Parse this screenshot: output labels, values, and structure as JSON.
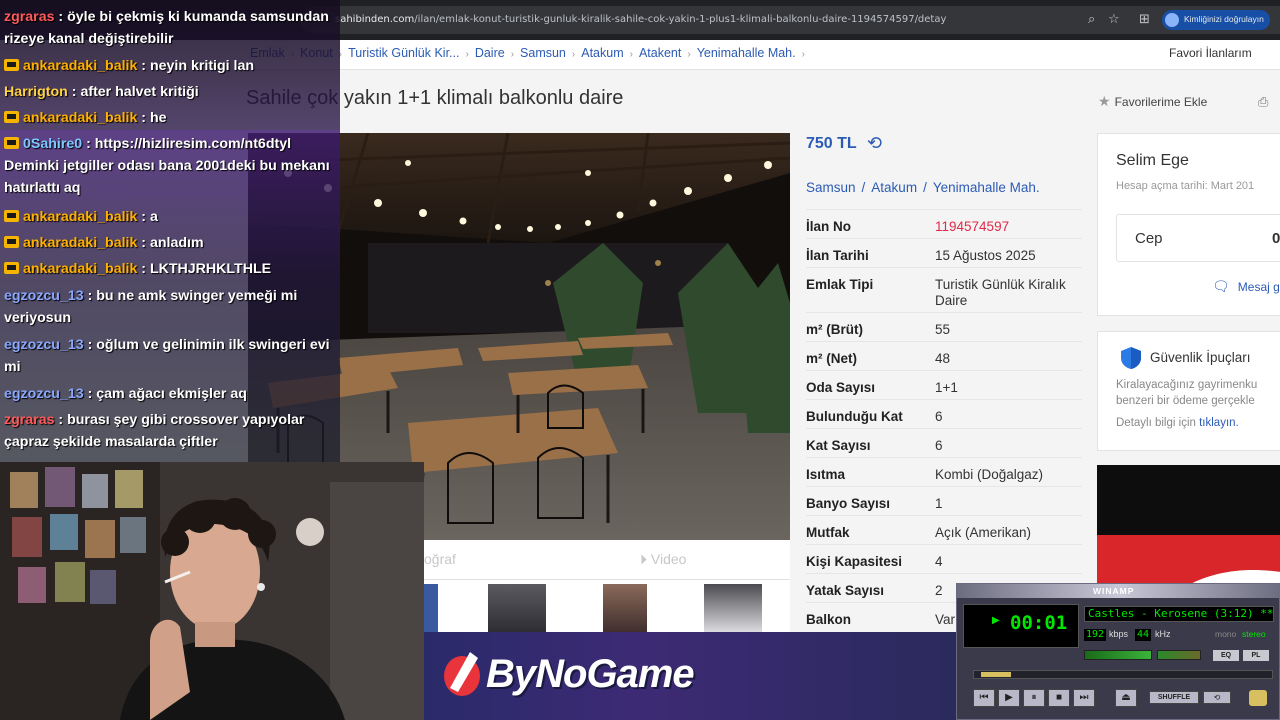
{
  "browser": {
    "url_prefix": "sahibinden.com",
    "url_path": "/ilan/emlak-konut-turistik-gunluk-kiralik-sahile-cok-yakin-1-plus1-klimali-balkonlu-daire-1194574597/detay",
    "verify_label": "Kimliğinizi doğrulayın"
  },
  "breadcrumbs": [
    "Emlak",
    "Konut",
    "Turistik Günlük Kir...",
    "Daire",
    "Samsun",
    "Atakum",
    "Atakent",
    "Yenimahalle Mah."
  ],
  "header": {
    "favorites_link": "Favori İlanlarım",
    "title": "Sahile çok yakın 1+1 klimalı balkonlu daire",
    "add_favorite": "Favorilerime Ekle",
    "print_label": "Y"
  },
  "photo_tabs": {
    "photo": "oğraf",
    "video": "Video"
  },
  "listing": {
    "price": "750 TL",
    "location": [
      "Samsun",
      "Atakum",
      "Yenimahalle Mah."
    ],
    "rows": [
      {
        "k": "İlan No",
        "v": "1194574597"
      },
      {
        "k": "İlan Tarihi",
        "v": "15 Ağustos 2025"
      },
      {
        "k": "Emlak Tipi",
        "v": "Turistik Günlük Kiralık Daire"
      },
      {
        "k": "m² (Brüt)",
        "v": "55"
      },
      {
        "k": "m² (Net)",
        "v": "48"
      },
      {
        "k": "Oda Sayısı",
        "v": "1+1"
      },
      {
        "k": "Bulunduğu Kat",
        "v": "6"
      },
      {
        "k": "Kat Sayısı",
        "v": "6"
      },
      {
        "k": "Isıtma",
        "v": "Kombi (Doğalgaz)"
      },
      {
        "k": "Banyo Sayısı",
        "v": "1"
      },
      {
        "k": "Mutfak",
        "v": "Açık (Amerikan)"
      },
      {
        "k": "Kişi Kapasitesi",
        "v": "4"
      },
      {
        "k": "Yatak Sayısı",
        "v": "2"
      },
      {
        "k": "Balkon",
        "v": "Var"
      }
    ]
  },
  "seller": {
    "name": "Selim Ege",
    "joined": "Hesap açma tarihi: Mart 201",
    "phone_label": "Cep",
    "phone_value": "0",
    "message": "Mesaj g"
  },
  "safety": {
    "title": "Güvenlik İpuçları",
    "line1": "Kiralayacağınız gayrimenku",
    "line2": "benzeri bir ödeme gerçekle",
    "more_prefix": "Detaylı bilgi için",
    "more_link": "tıklayın."
  },
  "chat": [
    {
      "user": "zgraras",
      "color": "#ff5a5a",
      "badge": false,
      "text": "öyle bi çekmiş ki kumanda samsundan rizeye kanal değiştirebilir"
    },
    {
      "user": "ankaradaki_balik",
      "color": "#ffb000",
      "badge": true,
      "text": "neyin kritigi lan"
    },
    {
      "user": "Harrigton",
      "color": "#ffd23f",
      "badge": false,
      "text": "after halvet kritiği"
    },
    {
      "user": "ankaradaki_balik",
      "color": "#ffb000",
      "badge": true,
      "text": "he"
    },
    {
      "user": "0Sahire0",
      "color": "#7ec8ff",
      "badge": true,
      "text": "https://hizliresim.com/nt6dtyl Deminki jetgiller odası bana 2001deki bu mekanı hatırlattı aq"
    },
    {
      "user": "ankaradaki_balik",
      "color": "#ffb000",
      "badge": true,
      "text": "a"
    },
    {
      "user": "ankaradaki_balik",
      "color": "#ffb000",
      "badge": true,
      "text": "anladım"
    },
    {
      "user": "ankaradaki_balik",
      "color": "#ffb000",
      "badge": true,
      "text": "LKTHJRHKLTHLE"
    },
    {
      "user": "egzozcu_13",
      "color": "#8aa8ff",
      "badge": false,
      "text": "bu ne amk swinger yemeği mi veriyosun"
    },
    {
      "user": "egzozcu_13",
      "color": "#8aa8ff",
      "badge": false,
      "text": "oğlum ve gelinimin ilk swingeri evi mi"
    },
    {
      "user": "egzozcu_13",
      "color": "#8aa8ff",
      "badge": false,
      "text": "çam ağacı ekmişler aq"
    },
    {
      "user": "zgraras",
      "color": "#ff5a5a",
      "badge": false,
      "text": "burası şey gibi crossover yapıyolar çapraz şekilde masalarda çiftler"
    }
  ],
  "banner": {
    "text": "ByNoGame"
  },
  "winamp": {
    "title": "WINAMP",
    "time": "00:01",
    "song": "Castles - Kerosene (3:12) *** 5.",
    "kbps": "192",
    "kbps_label": "kbps",
    "khz": "44",
    "khz_label": "kHz",
    "mono": "mono",
    "stereo": "stereo",
    "eq": "EQ",
    "pl": "PL",
    "shuffle": "SHUFFLE",
    "seek_fraction": 0.02
  },
  "colors": {
    "link_blue": "#2c5bb5",
    "listing_no_red": "#e0294a",
    "winamp_green": "#00e800"
  }
}
